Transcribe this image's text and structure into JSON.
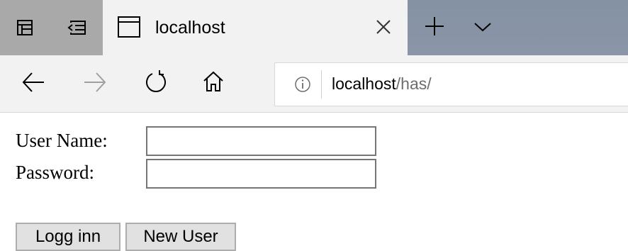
{
  "browser": {
    "tab": {
      "title": "localhost",
      "page_icon": "page-icon",
      "close_icon": "close-icon"
    },
    "tab_tools": {
      "set_aside_icon": "set-aside-tabs-icon",
      "show_tabs_icon": "show-tabs-aside-icon",
      "new_tab_icon": "plus-icon",
      "tab_list_icon": "chevron-down-icon"
    },
    "nav": {
      "back_icon": "back-arrow-icon",
      "forward_icon": "forward-arrow-icon",
      "refresh_icon": "refresh-icon",
      "home_icon": "home-icon"
    },
    "address": {
      "info_icon": "info-icon",
      "host": "localhost",
      "path": "/has/"
    }
  },
  "colors": {
    "tabstrip_bg": "#8a96a8",
    "active_tab_bg": "#f2f2f2",
    "tool_bg": "#a9a9a9",
    "url_path": "#6d6d6d",
    "button_bg": "#e1e1e1"
  },
  "form": {
    "username_label": "User Name:",
    "username_value": "",
    "password_label": "Password:",
    "password_value": "",
    "login_button": "Logg inn",
    "new_user_button": "New User"
  }
}
